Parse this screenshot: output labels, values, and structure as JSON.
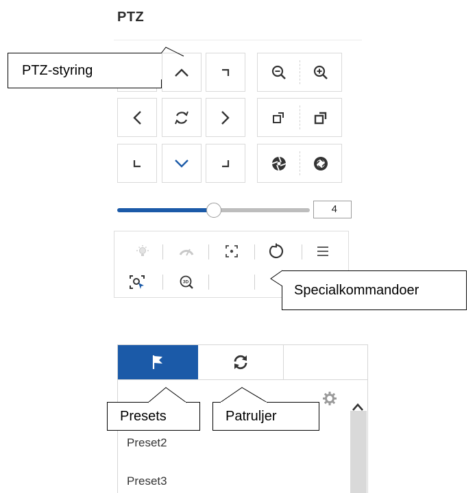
{
  "ptz": {
    "title": "PTZ",
    "direction_buttons": [
      {
        "name": "up",
        "icon": "chevron-up-icon"
      },
      {
        "name": "up-right",
        "icon": "corner-up-right-icon"
      },
      {
        "name": "left",
        "icon": "chevron-left-icon"
      },
      {
        "name": "auto-rotate",
        "icon": "rotate-icon"
      },
      {
        "name": "right",
        "icon": "chevron-right-icon"
      },
      {
        "name": "down-left",
        "icon": "corner-down-left-icon"
      },
      {
        "name": "down",
        "icon": "chevron-down-icon"
      },
      {
        "name": "down-right",
        "icon": "corner-down-right-icon"
      }
    ],
    "lens_buttons": [
      {
        "name": "zoom-out",
        "icon": "zoom-out-icon"
      },
      {
        "name": "zoom-in",
        "icon": "zoom-in-icon"
      },
      {
        "name": "focus-near",
        "icon": "focus-near-icon"
      },
      {
        "name": "focus-far",
        "icon": "focus-far-icon"
      },
      {
        "name": "iris-close",
        "icon": "iris-close-icon"
      },
      {
        "name": "iris-open",
        "icon": "iris-open-icon"
      }
    ],
    "speed": {
      "value": "4",
      "level_fraction": 0.45
    },
    "special_commands": [
      "light-icon",
      "wiper-icon",
      "focus-assist-icon",
      "lens-init-icon",
      "menu-icon",
      "manual-track-icon",
      "3d-zoom-icon"
    ]
  },
  "presets_panel": {
    "tabs": [
      {
        "name": "presets",
        "icon": "flag-icon",
        "active": true
      },
      {
        "name": "patrols",
        "icon": "refresh-icon",
        "active": false
      },
      {
        "name": "empty",
        "icon": "",
        "active": false
      }
    ],
    "items": [
      "Preset2",
      "Preset3"
    ],
    "settings_icon": "gear-icon",
    "scroll_up_icon": "chevron-up-icon"
  },
  "callouts": {
    "ptz_control": "PTZ-styring",
    "special_commands": "Specialkommandoer",
    "presets": "Presets",
    "patrols": "Patruljer"
  },
  "colors": {
    "accent": "#1b5aa8",
    "border": "#d9d9d9",
    "slider_rest": "#bdbdbd"
  }
}
